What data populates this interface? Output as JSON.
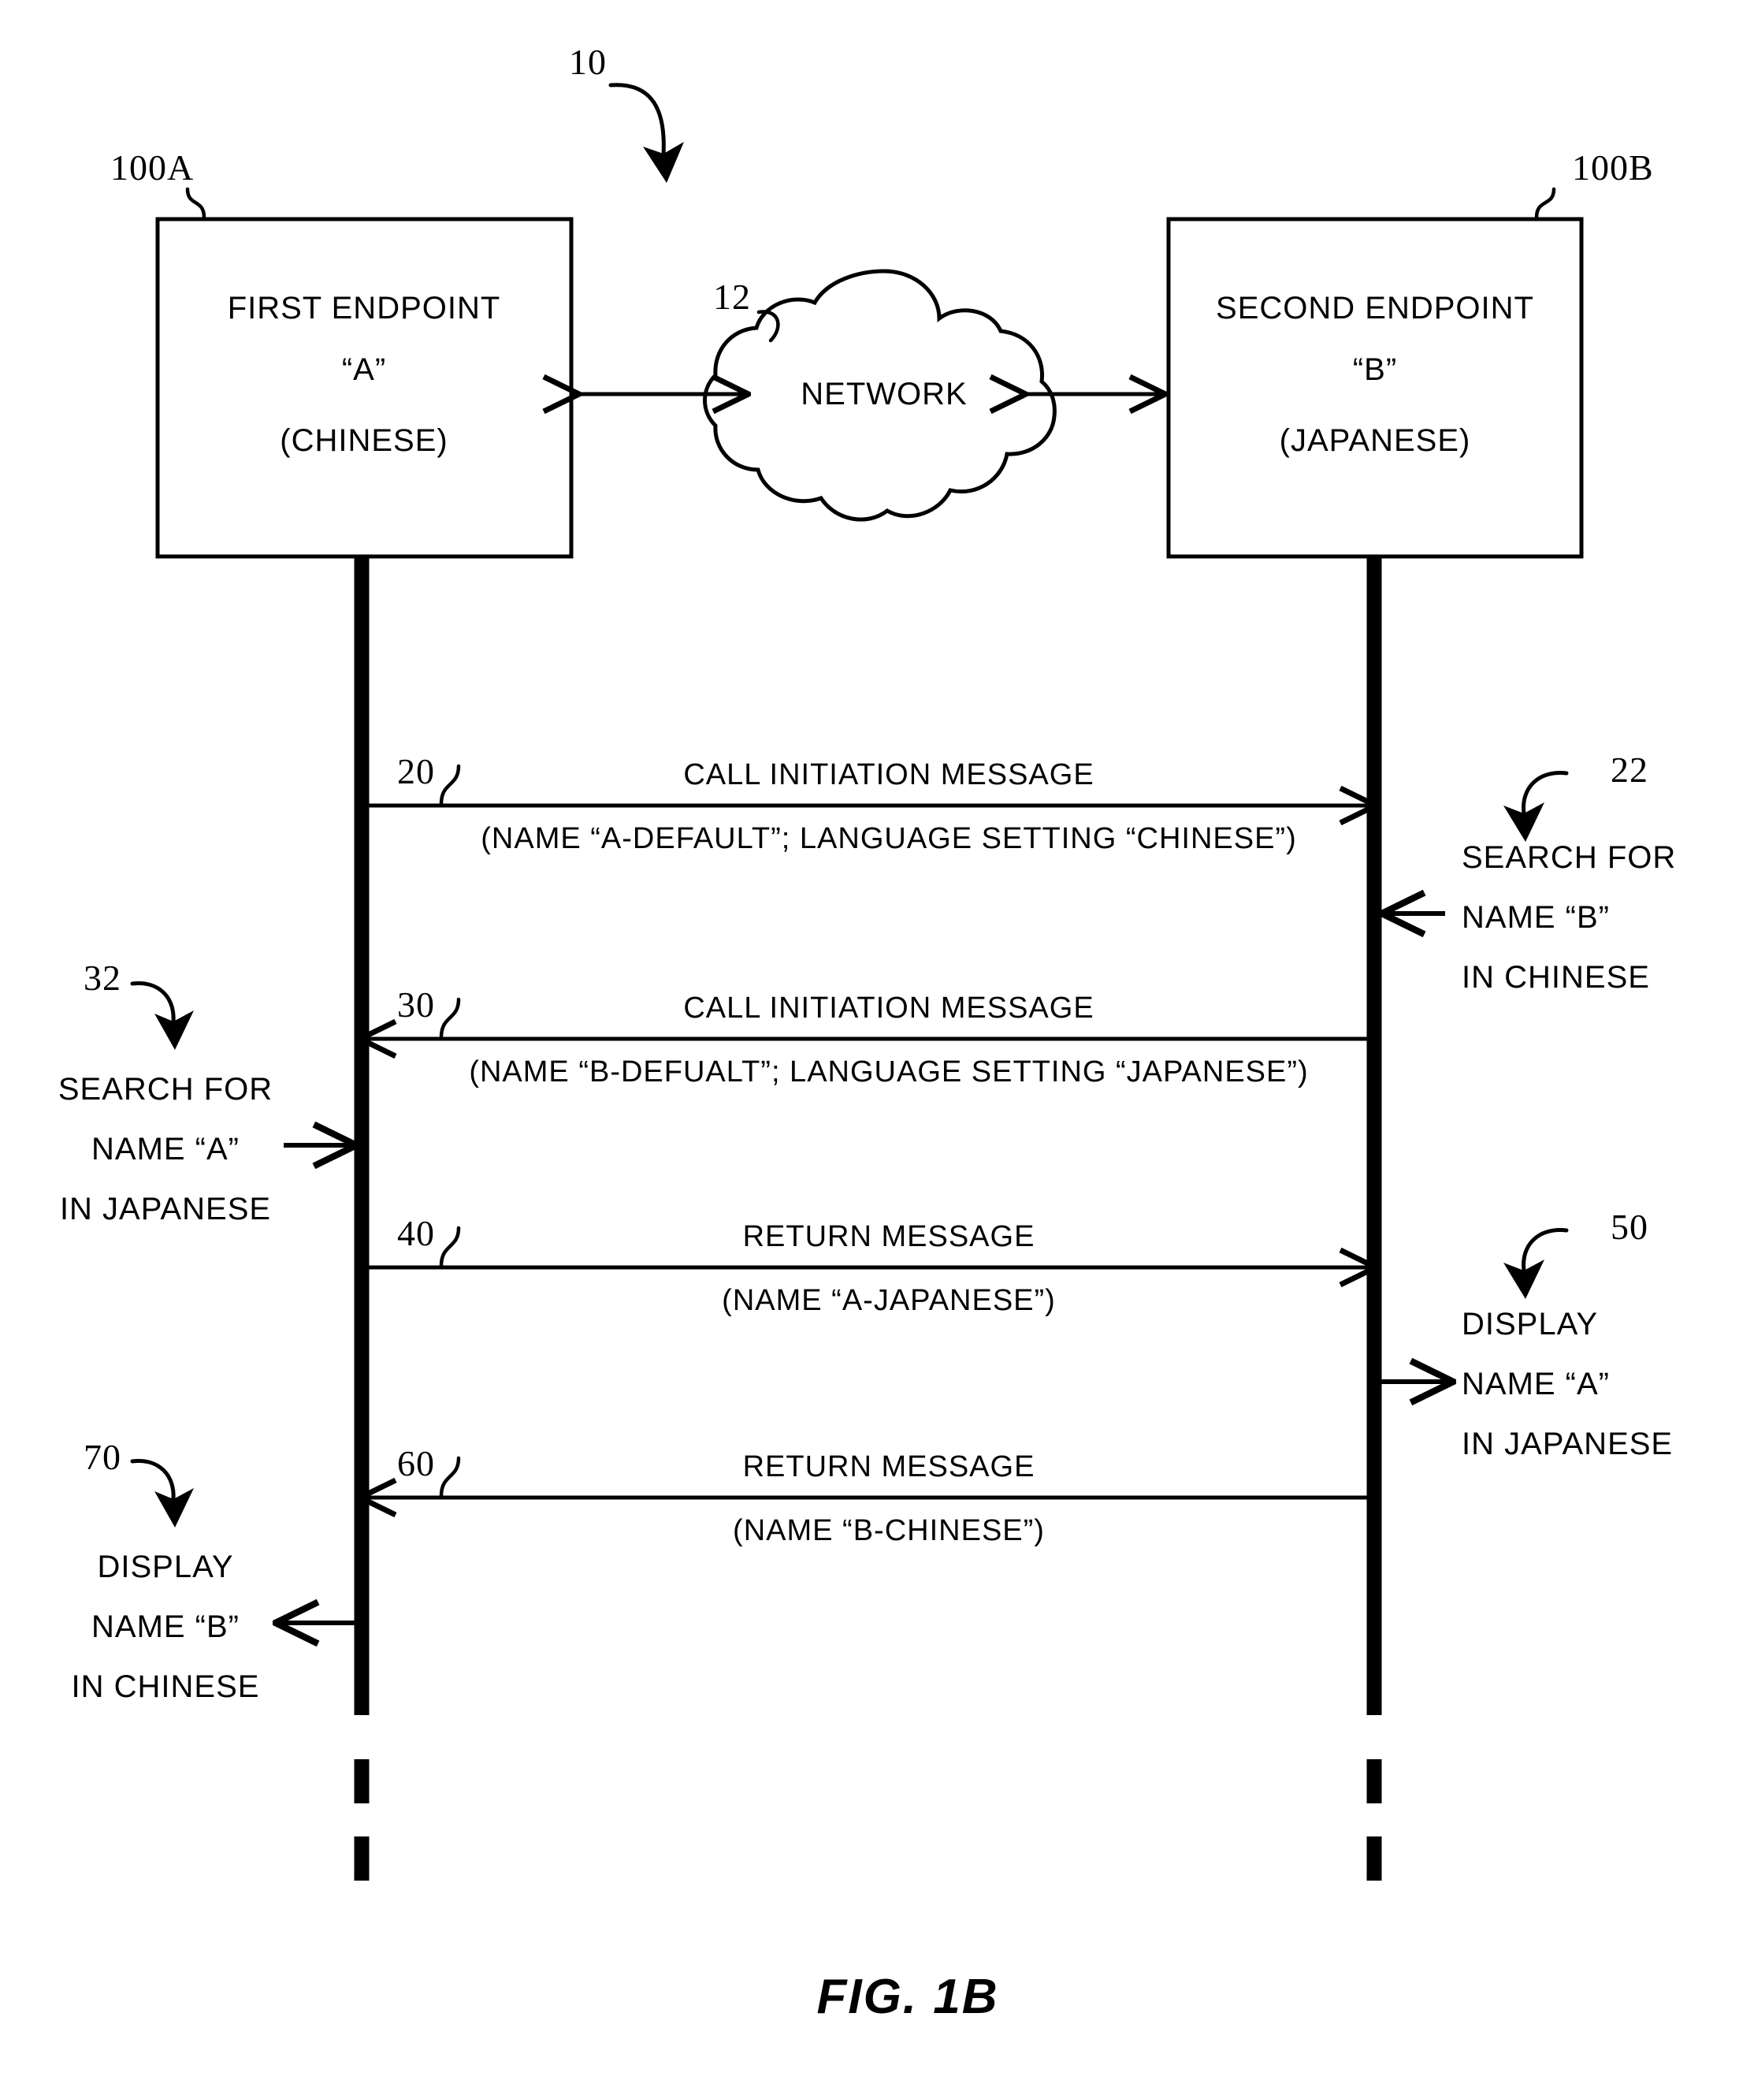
{
  "figure": {
    "caption": "FIG. 1B",
    "system_ref": "10",
    "title_hidden": ""
  },
  "endpoints": [
    {
      "ref": "100A",
      "line1": "FIRST ENDPOINT",
      "line2": "“A”",
      "line3": "(CHINESE)"
    },
    {
      "ref": "100B",
      "line1": "SECOND ENDPOINT",
      "line2": "“B”",
      "line3": "(JAPANESE)"
    }
  ],
  "network": {
    "ref": "12",
    "label": "NETWORK"
  },
  "messages": [
    {
      "ref": "20",
      "title": "CALL INITIATION MESSAGE",
      "detail": "(NAME “A-DEFAULT”; LANGUAGE SETTING “CHINESE”)",
      "direction": "left-to-right"
    },
    {
      "ref": "30",
      "title": "CALL INITIATION MESSAGE",
      "detail": "(NAME “B-DEFUALT”; LANGUAGE SETTING “JAPANESE”)",
      "direction": "right-to-left"
    },
    {
      "ref": "40",
      "title": "RETURN MESSAGE",
      "detail": "(NAME “A-JAPANESE”)",
      "direction": "left-to-right"
    },
    {
      "ref": "60",
      "title": "RETURN MESSAGE",
      "detail": "(NAME “B-CHINESE”)",
      "direction": "right-to-left"
    }
  ],
  "annotations": [
    {
      "ref": "22",
      "side": "right",
      "line1": "SEARCH FOR",
      "line2": "NAME “B”",
      "line3": "IN CHINESE"
    },
    {
      "ref": "32",
      "side": "left",
      "line1": "SEARCH FOR",
      "line2": "NAME “A”",
      "line3": "IN JAPANESE"
    },
    {
      "ref": "50",
      "side": "right",
      "line1": "DISPLAY",
      "line2": "NAME “A”",
      "line3": "IN JAPANESE"
    },
    {
      "ref": "70",
      "side": "left",
      "line1": "DISPLAY",
      "line2": "NAME “B”",
      "line3": "IN CHINESE"
    }
  ],
  "colors": {
    "ink": "#000000",
    "background": "#ffffff"
  }
}
